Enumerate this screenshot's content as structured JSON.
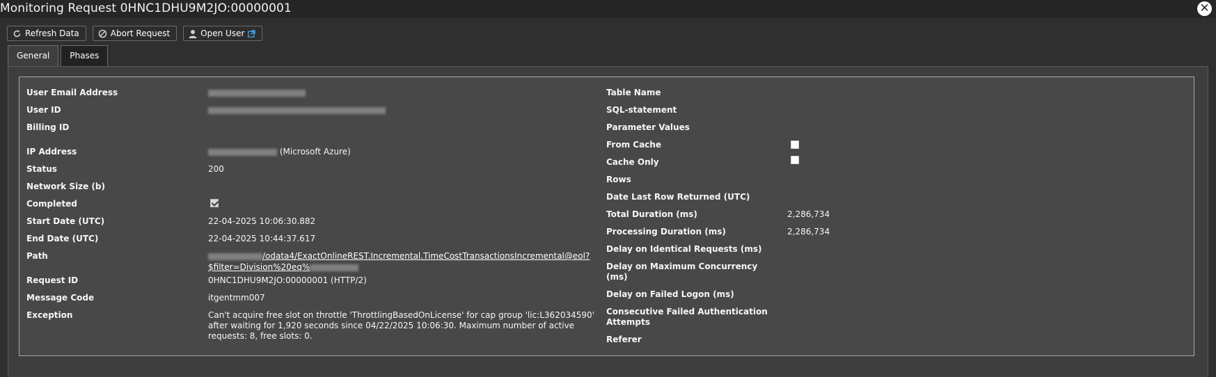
{
  "window": {
    "title": "Monitoring Request 0HNC1DHU9M2JO:00000001",
    "close_icon": "close-icon"
  },
  "toolbar": {
    "refresh_label": "Refresh Data",
    "abort_label": "Abort Request",
    "open_user_label": "Open User"
  },
  "tabs": [
    {
      "label": "General",
      "active": true
    },
    {
      "label": "Phases",
      "active": false
    }
  ],
  "general": {
    "user_email": {
      "label": "User Email Address",
      "value": ""
    },
    "user_id": {
      "label": "User ID",
      "value": ""
    },
    "billing_id": {
      "label": "Billing ID",
      "value": ""
    },
    "ip_address": {
      "label": "IP Address",
      "value_suffix": "(Microsoft Azure)"
    },
    "status": {
      "label": "Status",
      "value": "200"
    },
    "network_size": {
      "label": "Network Size (b)",
      "value": ""
    },
    "completed": {
      "label": "Completed",
      "checked": true
    },
    "start_date": {
      "label": "Start Date (UTC)",
      "value": "22-04-2025 10:06:30.882"
    },
    "end_date": {
      "label": "End Date (UTC)",
      "value": "22-04-2025 10:44:37.617"
    },
    "path": {
      "label": "Path",
      "line1": "/odata4/ExactOnlineREST.Incremental.TimeCostTransactionsIncremental@eol?",
      "line2": "$filter=Division%20eq%"
    },
    "request_id": {
      "label": "Request ID",
      "value": "0HNC1DHU9M2JO:00000001 (HTTP/2)"
    },
    "message_code": {
      "label": "Message Code",
      "value": "itgentmm007"
    },
    "exception": {
      "label": "Exception",
      "line1": "Can't acquire free slot on throttle 'ThrottlingBasedOnLicense' for cap group 'lic:L362034590'",
      "line2": "after waiting for 1,920 seconds since 04/22/2025 10:06:30. Maximum number of active",
      "line3": "requests: 8, free slots: 0."
    }
  },
  "right": {
    "table_name": {
      "label": "Table Name",
      "value": ""
    },
    "sql_statement": {
      "label": "SQL-statement",
      "value": ""
    },
    "parameter_values": {
      "label": "Parameter Values",
      "value": ""
    },
    "from_cache": {
      "label": "From Cache",
      "checked": false
    },
    "cache_only": {
      "label": "Cache Only",
      "checked": false
    },
    "rows": {
      "label": "Rows",
      "value": ""
    },
    "date_last_row": {
      "label": "Date Last Row Returned (UTC)",
      "value": ""
    },
    "total_duration": {
      "label": "Total Duration (ms)",
      "value": "2,286,734"
    },
    "processing_duration": {
      "label": "Processing Duration (ms)",
      "value": "2,286,734"
    },
    "delay_identical": {
      "label": "Delay on Identical Requests (ms)",
      "value": ""
    },
    "delay_concurrency": {
      "label_line1": "Delay on Maximum Concurrency",
      "label_line2": "(ms)",
      "value": ""
    },
    "delay_failed_logon": {
      "label": "Delay on Failed Logon (ms)",
      "value": ""
    },
    "consecutive_failed": {
      "label_line1": "Consecutive Failed Authentication",
      "label_line2": "Attempts",
      "value": ""
    },
    "referer": {
      "label": "Referer",
      "value": ""
    }
  },
  "colors": {
    "background": "#2f2f2f",
    "panel": "#3e3e3e",
    "details_box": "#484848",
    "text": "#f6f6f6"
  }
}
